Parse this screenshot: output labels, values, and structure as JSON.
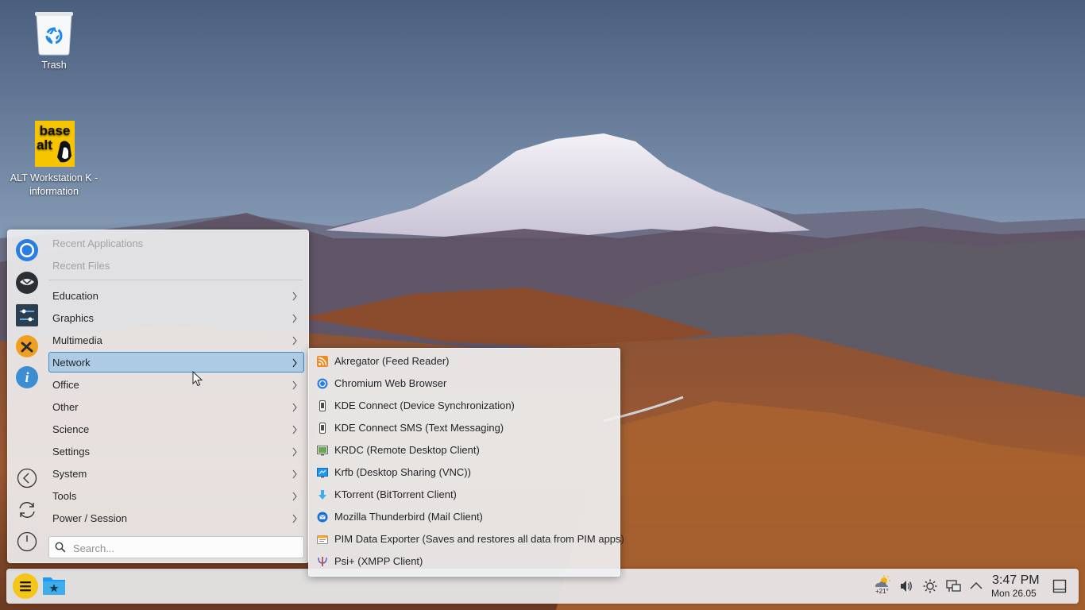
{
  "desktop": {
    "icons": [
      {
        "label": "Trash"
      },
      {
        "label": "ALT Workstation K - information",
        "logo_text_top": "base",
        "logo_text_bottom": "alt"
      }
    ]
  },
  "launcher": {
    "favorites": [
      {
        "icon": "chromium-icon"
      },
      {
        "icon": "thunderbird-icon"
      },
      {
        "icon": "system-settings-icon"
      },
      {
        "icon": "alt-tools-icon"
      },
      {
        "icon": "info-center-icon"
      }
    ],
    "system_buttons": [
      {
        "icon": "leave-icon"
      },
      {
        "icon": "restart-icon"
      },
      {
        "icon": "shutdown-icon"
      }
    ],
    "recent": [
      "Recent Applications",
      "Recent Files"
    ],
    "categories": [
      "Education",
      "Graphics",
      "Multimedia",
      "Network",
      "Office",
      "Other",
      "Science",
      "Settings",
      "System",
      "Tools",
      "Power / Session"
    ],
    "active_category": "Network",
    "search": {
      "placeholder": "Search..."
    }
  },
  "network_submenu": [
    {
      "label": "Akregator (Feed Reader)",
      "icon": "rss-icon"
    },
    {
      "label": "Chromium Web Browser",
      "icon": "chromium-icon"
    },
    {
      "label": "KDE Connect (Device Synchronization)",
      "icon": "phone-icon"
    },
    {
      "label": "KDE Connect SMS (Text Messaging)",
      "icon": "phone-icon"
    },
    {
      "label": "KRDC (Remote Desktop Client)",
      "icon": "remote-desktop-icon"
    },
    {
      "label": "Krfb (Desktop Sharing (VNC))",
      "icon": "desktop-sharing-icon"
    },
    {
      "label": "KTorrent (BitTorrent Client)",
      "icon": "torrent-icon"
    },
    {
      "label": "Mozilla Thunderbird (Mail Client)",
      "icon": "thunderbird-icon"
    },
    {
      "label": "PIM Data Exporter (Saves and restores all data from PIM apps)",
      "icon": "pim-exporter-icon"
    },
    {
      "label": "Psi+ (XMPP Client)",
      "icon": "psi-icon"
    }
  ],
  "taskbar": {
    "weather_temp": "+21°",
    "clock_time": "3:47 PM",
    "clock_date": "Mon 26.05"
  },
  "colors": {
    "accent": "#3d8dd1",
    "highlight": "#aecbe6",
    "menu_bg": "#eff0f1",
    "launcher_button": "#f5c518"
  }
}
